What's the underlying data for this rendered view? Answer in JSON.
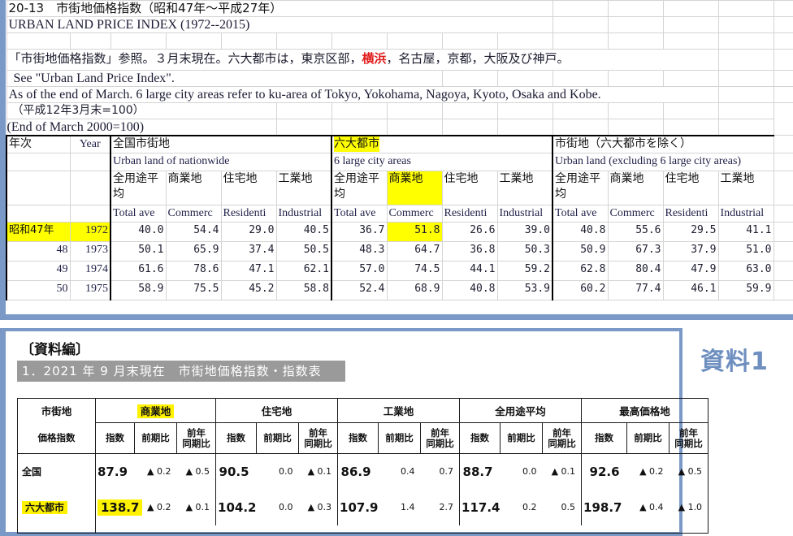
{
  "top_sheet": {
    "title_jp": "20-13　市街地価格指数（昭和47年〜平成27年）",
    "title_en": "URBAN LAND PRICE INDEX (1972--2015)",
    "note_jp_a": "「市街地価格指数」参照。３月末現在。六大都市は，東京区部，",
    "note_jp_highlight": "横浜",
    "note_jp_b": "，名古屋，京都，大阪及び神戸。",
    "note_en_1": "See \"Urban Land Price Index\".",
    "note_en_2": "As of the end of March. 6 large city areas refer to ku-area of Tokyo, Yokohama, Nagoya, Kyoto, Osaka and Kobe.",
    "base_jp": "（平成12年3月末=100）",
    "base_en": "(End of March 2000=100)",
    "col_year_jp": "年次",
    "col_year_en": "Year",
    "groups": [
      {
        "jp": "全国市街地",
        "en": "Urban land of nationwide",
        "highlight": false
      },
      {
        "jp": "六大都市",
        "en": "6 large city areas",
        "highlight": true
      },
      {
        "jp": "市街地（六大都市を除く）",
        "en": "Urban land (excluding 6 large city areas)",
        "highlight": false
      }
    ],
    "subcols_jp": [
      "全用途平均",
      "商業地",
      "住宅地",
      "工業地"
    ],
    "subcols_en": [
      "Total ave",
      "Commerc",
      "Residenti",
      "Industrial"
    ],
    "subcol_highlight_group": 1,
    "subcol_highlight_index": 1,
    "rows": [
      {
        "era": "昭和47年",
        "year": "1972",
        "highlight_year": true,
        "values": [
          "40.0",
          "54.4",
          "29.0",
          "40.5",
          "36.7",
          "51.8",
          "26.6",
          "39.0",
          "40.8",
          "55.6",
          "29.5",
          "41.1"
        ],
        "highlight_cells": [
          5
        ]
      },
      {
        "era": "48",
        "year": "1973",
        "highlight_year": false,
        "values": [
          "50.1",
          "65.9",
          "37.4",
          "50.5",
          "48.3",
          "64.7",
          "36.8",
          "50.3",
          "50.9",
          "67.3",
          "37.9",
          "51.0"
        ],
        "highlight_cells": []
      },
      {
        "era": "49",
        "year": "1974",
        "highlight_year": false,
        "values": [
          "61.6",
          "78.6",
          "47.1",
          "62.1",
          "57.0",
          "74.5",
          "44.1",
          "59.2",
          "62.8",
          "80.4",
          "47.9",
          "63.0"
        ],
        "highlight_cells": []
      },
      {
        "era": "50",
        "year": "1975",
        "highlight_year": false,
        "values": [
          "58.9",
          "75.5",
          "45.2",
          "58.8",
          "52.4",
          "68.9",
          "40.8",
          "53.9",
          "60.2",
          "77.4",
          "46.1",
          "59.9"
        ],
        "highlight_cells": []
      }
    ]
  },
  "bottom_panel": {
    "shiryo_hen": "〔資料編〕",
    "band_title": "1．2021 年 9 月末現在　市街地価格指数・指数表",
    "side_label": "資料1",
    "corner_line1": "市街地",
    "corner_line2": "価格指数",
    "groups": [
      {
        "label": "商業地",
        "highlight": true
      },
      {
        "label": "住宅地",
        "highlight": false
      },
      {
        "label": "工業地",
        "highlight": false
      },
      {
        "label": "全用途平均",
        "highlight": false
      },
      {
        "label": "最高価格地",
        "highlight": false
      }
    ],
    "subheaders": [
      "指数",
      "前期比",
      "前年\n同期比"
    ],
    "subheader_idx": "指数",
    "subheader_prev": "前期比",
    "subheader_yoy_l1": "前年",
    "subheader_yoy_l2": "同期比",
    "rows": [
      {
        "label": "全国",
        "label_highlight": false,
        "cells": [
          {
            "index": "87.9",
            "index_highlight": false,
            "prev": "▲ 0.2",
            "yoy": "▲ 0.5"
          },
          {
            "index": "90.5",
            "index_highlight": false,
            "prev": "0.0",
            "yoy": "▲ 0.1"
          },
          {
            "index": "86.9",
            "index_highlight": false,
            "prev": "0.4",
            "yoy": "0.7"
          },
          {
            "index": "88.7",
            "index_highlight": false,
            "prev": "0.0",
            "yoy": "▲ 0.1"
          },
          {
            "index": "92.6",
            "index_highlight": false,
            "prev": "▲ 0.2",
            "yoy": "▲ 0.5"
          }
        ]
      },
      {
        "label": "六大都市",
        "label_highlight": true,
        "cells": [
          {
            "index": "138.7",
            "index_highlight": true,
            "prev": "▲ 0.2",
            "yoy": "▲ 0.1"
          },
          {
            "index": "104.2",
            "index_highlight": false,
            "prev": "0.0",
            "yoy": "▲ 0.3"
          },
          {
            "index": "107.9",
            "index_highlight": false,
            "prev": "1.4",
            "yoy": "2.7"
          },
          {
            "index": "117.4",
            "index_highlight": false,
            "prev": "0.2",
            "yoy": "0.5"
          },
          {
            "index": "198.7",
            "index_highlight": false,
            "prev": "▲ 0.4",
            "yoy": "▲ 1.0"
          }
        ]
      }
    ]
  },
  "colors": {
    "frame_blue": "#7A99C6",
    "highlight_yellow": "#FFFF00",
    "highlight_yellow_strong": "#FFF200",
    "accent_red": "#E01B1B",
    "band_gray": "#9A9A9A",
    "label_blue": "#6E8FC0"
  }
}
